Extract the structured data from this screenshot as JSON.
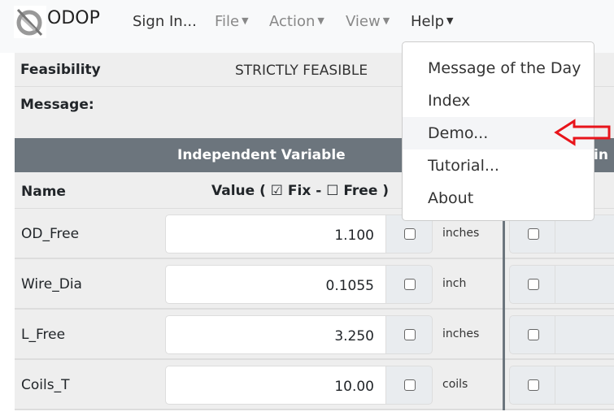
{
  "navbar": {
    "brand": "ODOP",
    "sign_in": "Sign In...",
    "menus": [
      "File",
      "Action",
      "View",
      "Help"
    ]
  },
  "status": {
    "feasibility_label": "Feasibility",
    "feasibility_value": "STRICTLY FEASIBLE",
    "message_label": "Message:"
  },
  "table": {
    "section_header": "Independent Variable",
    "right_header_partial": "in",
    "name_header": "Name",
    "value_header": "Value ( ☑ Fix - ☐ Free )",
    "rows": [
      {
        "name": "OD_Free",
        "value": "1.100",
        "unit": "inches"
      },
      {
        "name": "Wire_Dia",
        "value": "0.1055",
        "unit": "inch"
      },
      {
        "name": "L_Free",
        "value": "3.250",
        "unit": "inches"
      },
      {
        "name": "Coils_T",
        "value": "10.00",
        "unit": "coils"
      }
    ]
  },
  "help_menu": {
    "items": [
      "Message of the Day",
      "Index",
      "Demo...",
      "Tutorial...",
      "About"
    ],
    "active": "Demo..."
  },
  "colors": {
    "header": "#6c757d",
    "annotation_arrow": "#e8141b"
  }
}
